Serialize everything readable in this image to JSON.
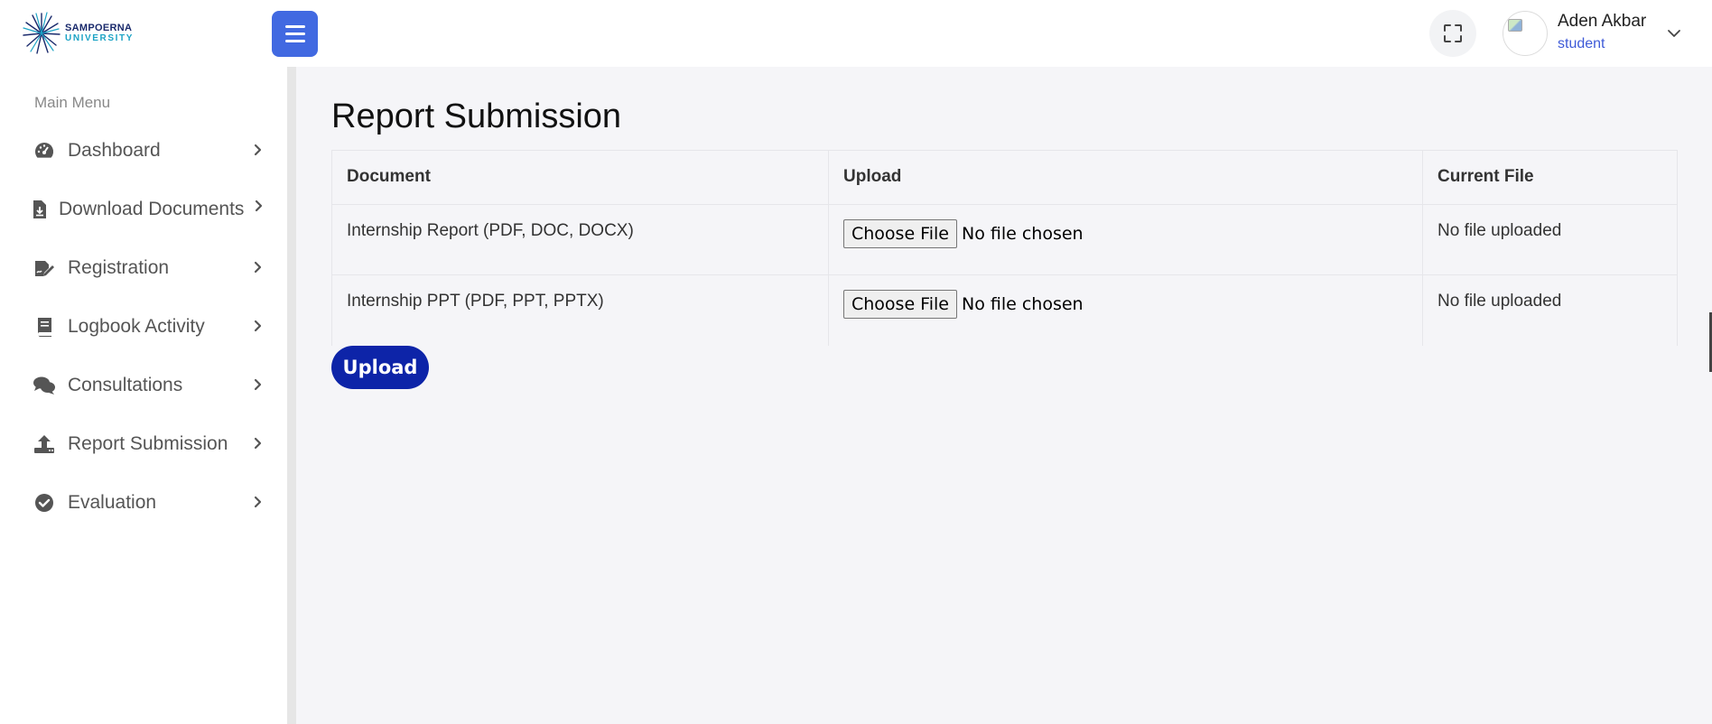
{
  "brand": {
    "line1": "SAMPOERNA",
    "line2": "UNIVERSITY",
    "colors": {
      "primary": "#1a2a6c",
      "accent": "#1ca3c5"
    }
  },
  "header": {
    "menu_toggle_icon": "hamburger-icon",
    "fullscreen_icon": "fullscreen-icon",
    "user": {
      "name": "Aden Akbar",
      "role": "student"
    },
    "accent_color": "#4169e1"
  },
  "sidebar": {
    "title": "Main Menu",
    "items": [
      {
        "label": "Dashboard",
        "icon": "gauge-icon"
      },
      {
        "label": "Download Documents",
        "icon": "file-download-icon"
      },
      {
        "label": "Registration",
        "icon": "signature-icon"
      },
      {
        "label": "Logbook Activity",
        "icon": "book-icon"
      },
      {
        "label": "Consultations",
        "icon": "comments-icon"
      },
      {
        "label": "Report Submission",
        "icon": "upload-icon"
      },
      {
        "label": "Evaluation",
        "icon": "check-circle-icon"
      }
    ]
  },
  "main": {
    "title": "Report Submission",
    "table": {
      "headers": [
        "Document",
        "Upload",
        "Current File"
      ],
      "rows": [
        {
          "document": "Internship Report (PDF, DOC, DOCX)",
          "choose_label": "Choose File",
          "chosen": "No file chosen",
          "current": "No file uploaded"
        },
        {
          "document": "Internship PPT (PDF, PPT, PPTX)",
          "choose_label": "Choose File",
          "chosen": "No file chosen",
          "current": "No file uploaded"
        }
      ]
    },
    "upload_label": "Upload",
    "upload_color": "#0d24a8"
  }
}
